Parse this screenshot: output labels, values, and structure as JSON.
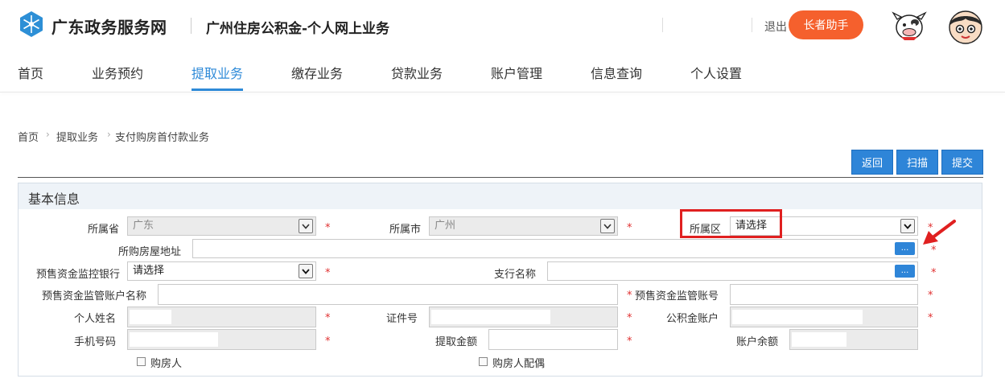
{
  "header": {
    "site_name": "广东政务服务网",
    "subtitle": "广州住房公积金-个人网上业务",
    "logout": "退出",
    "elder_button": "长者助手",
    "logo_icon": "snowflake-logo-icon"
  },
  "nav": {
    "items": [
      "首页",
      "业务预约",
      "提取业务",
      "缴存业务",
      "贷款业务",
      "账户管理",
      "信息查询",
      "个人设置"
    ],
    "active_index": 2
  },
  "breadcrumb": [
    "首页",
    "提取业务",
    "支付购房首付款业务"
  ],
  "actions": {
    "back": "返回",
    "scan": "扫描",
    "submit": "提交"
  },
  "panel": {
    "title": "基本信息",
    "fields": {
      "province": {
        "label": "所属省",
        "value": "广东"
      },
      "city": {
        "label": "所属市",
        "value": "广州"
      },
      "district": {
        "label": "所属区",
        "value": "请选择"
      },
      "address": {
        "label": "所购房屋地址",
        "value": ""
      },
      "bank": {
        "label": "预售资金监控银行",
        "value": "请选择"
      },
      "branch": {
        "label": "支行名称",
        "value": ""
      },
      "acct_name": {
        "label": "预售资金监管账户名称",
        "value": ""
      },
      "acct_no": {
        "label": "预售资金监管账号",
        "value": ""
      },
      "name": {
        "label": "个人姓名",
        "value": ""
      },
      "id_no": {
        "label": "证件号",
        "value": ""
      },
      "fund_acct": {
        "label": "公积金账户",
        "value": ""
      },
      "phone": {
        "label": "手机号码",
        "value": ""
      },
      "amount": {
        "label": "提取金额",
        "value": ""
      },
      "balance": {
        "label": "账户余额",
        "value": ""
      }
    },
    "checkboxes": {
      "buyer": "购房人",
      "spouse": "购房人配偶"
    },
    "required_mark": "*",
    "browse_label": "..."
  },
  "colors": {
    "accent": "#2e85d8",
    "elder": "#f5602d",
    "highlight": "#e02020"
  }
}
